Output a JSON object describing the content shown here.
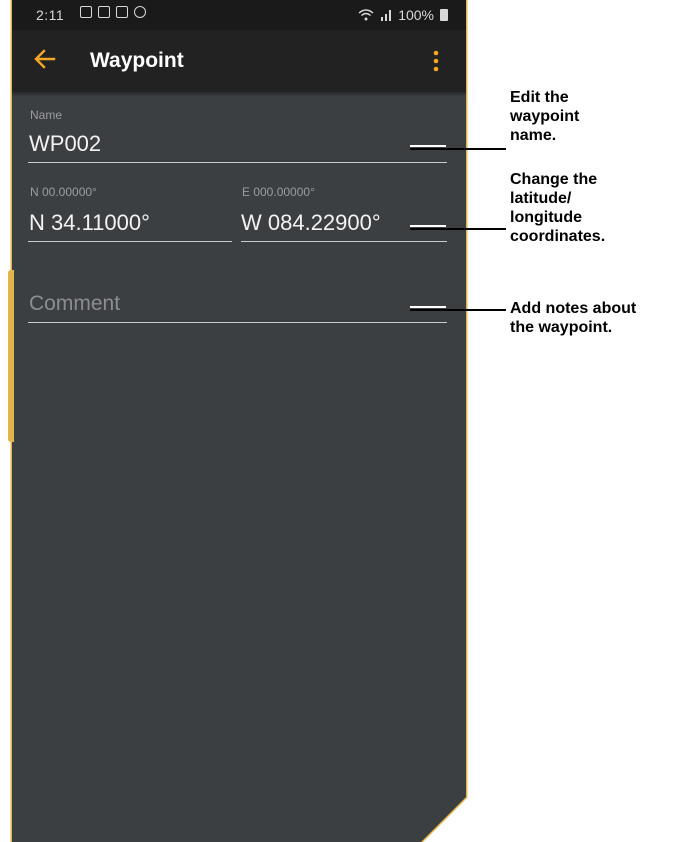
{
  "status_bar": {
    "time": "2:11",
    "signal_text": "ᴵ▐",
    "battery_text": "100%"
  },
  "app_bar": {
    "title": "Waypoint",
    "back_icon": "arrow-left-icon",
    "more_icon": "more-vertical-icon"
  },
  "form": {
    "name": {
      "label": "Name",
      "value": "WP002"
    },
    "latitude": {
      "label": "N 00.00000°",
      "value": "N 34.11000°"
    },
    "longitude": {
      "label": "E 000.00000°",
      "value": "W 084.22900°"
    },
    "comment": {
      "placeholder": "Comment"
    }
  },
  "callouts": [
    {
      "text": "Edit the\nwaypoint\nname."
    },
    {
      "text": "Change the\nlatitude/\nlongitude\ncoordinates."
    },
    {
      "text": "Add notes about\nthe waypoint."
    }
  ],
  "colors": {
    "accent": "#f5a623",
    "app_bar_bg": "#222222",
    "screen_bg": "#3c3f42",
    "frame": "#e1b44c"
  }
}
